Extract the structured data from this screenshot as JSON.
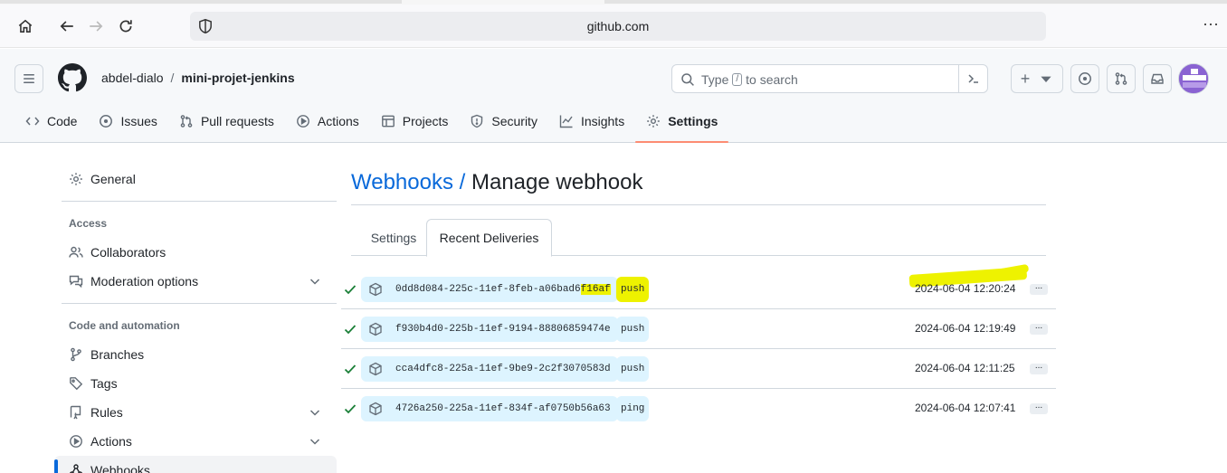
{
  "browser": {
    "url": "github.com",
    "icons": [
      "home-icon",
      "back-icon",
      "forward-icon",
      "reload-icon",
      "shield-icon",
      "more-icon"
    ]
  },
  "header": {
    "owner": "abdel-dialo",
    "separator": "/",
    "repo": "mini-projet-jenkins",
    "search_prefix": "Type",
    "search_key": "/",
    "search_suffix": "to search",
    "add_label": "+"
  },
  "repo_tabs": [
    {
      "label": "Code",
      "icon": "code-icon"
    },
    {
      "label": "Issues",
      "icon": "issue-icon"
    },
    {
      "label": "Pull requests",
      "icon": "pull-request-icon"
    },
    {
      "label": "Actions",
      "icon": "play-icon"
    },
    {
      "label": "Projects",
      "icon": "table-icon"
    },
    {
      "label": "Security",
      "icon": "shield-icon"
    },
    {
      "label": "Insights",
      "icon": "graph-icon"
    },
    {
      "label": "Settings",
      "icon": "gear-icon",
      "selected": true
    }
  ],
  "sidebar": {
    "general": "General",
    "access_heading": "Access",
    "collaborators": "Collaborators",
    "moderation": "Moderation options",
    "code_heading": "Code and automation",
    "branches": "Branches",
    "tags": "Tags",
    "rules": "Rules",
    "actions": "Actions",
    "webhooks": "Webhooks"
  },
  "main": {
    "title_link": "Webhooks",
    "title_sep": "/",
    "title_rest": "Manage webhook",
    "tabs": [
      "Settings",
      "Recent Deliveries"
    ],
    "selected_tab": "Recent Deliveries"
  },
  "deliveries": [
    {
      "guid_main": "0dd8d084-225c-11ef-8feb-a06bad6",
      "guid_tail": "f16af",
      "event": "push",
      "time": "2024-06-04 12:20:24",
      "highlighted": true
    },
    {
      "guid_main": "f930b4d0-225b-11ef-9194-88806859474e",
      "guid_tail": "",
      "event": "push",
      "time": "2024-06-04 12:19:49",
      "highlighted": false
    },
    {
      "guid_main": "cca4dfc8-225a-11ef-9be9-2c2f3070583d",
      "guid_tail": "",
      "event": "push",
      "time": "2024-06-04 12:11:25",
      "highlighted": false
    },
    {
      "guid_main": "4726a250-225a-11ef-834f-af0750b56a63",
      "guid_tail": "",
      "event": "ping",
      "time": "2024-06-04 12:07:41",
      "highlighted": false
    }
  ],
  "more_label": "...",
  "colors": {
    "accent": "#0969da",
    "tab_underline": "#fd8c73",
    "pill": "#ddf4ff",
    "check": "#1a7f37",
    "highlight": "#eef200"
  }
}
